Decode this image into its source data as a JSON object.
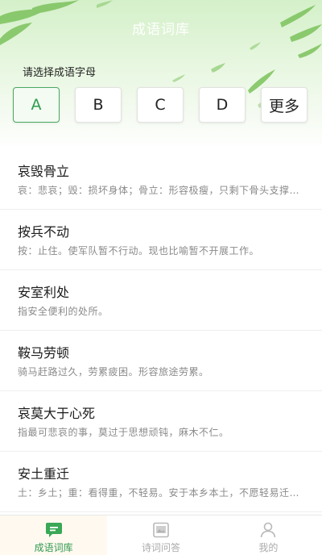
{
  "header": {
    "title": "成语词库",
    "subtitle": "请选择成语字母"
  },
  "letters": [
    {
      "label": "A",
      "active": true
    },
    {
      "label": "B",
      "active": false
    },
    {
      "label": "C",
      "active": false
    },
    {
      "label": "D",
      "active": false
    },
    {
      "label": "更多",
      "active": false
    }
  ],
  "idioms": [
    {
      "title": "哀毁骨立",
      "desc": "哀：悲哀；毁：损坏身体；骨立：形容极瘦，只剩下骨头支撑着身体。"
    },
    {
      "title": "按兵不动",
      "desc": "按：止住。使军队暂不行动。现也比喻暂不开展工作。"
    },
    {
      "title": "安室利处",
      "desc": "指安全便利的处所。"
    },
    {
      "title": "鞍马劳顿",
      "desc": "骑马赶路过久，劳累疲困。形容旅途劳累。"
    },
    {
      "title": "哀莫大于心死",
      "desc": "指最可悲哀的事，莫过于思想顽钝，麻木不仁。"
    },
    {
      "title": "安土重迁",
      "desc": "土：乡土；重：看得重，不轻易。安于本乡本土，不愿轻易迁移。"
    }
  ],
  "tabbar": {
    "items": [
      {
        "label": "成语词库",
        "icon": "chat-bubble-icon",
        "active": true
      },
      {
        "label": "诗词问答",
        "icon": "picture-book-icon",
        "active": false
      },
      {
        "label": "我的",
        "icon": "person-icon",
        "active": false
      }
    ]
  },
  "colors": {
    "accent": "#2f9a4e",
    "header_gradient_top": "#d4f0c9",
    "inactive_text": "#aaaaaa"
  }
}
